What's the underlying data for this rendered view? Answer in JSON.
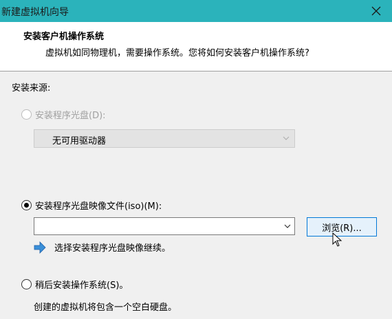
{
  "window": {
    "title": "新建虚拟机向导"
  },
  "header": {
    "title": "安装客户机操作系统",
    "description": "虚拟机如同物理机，需要操作系统。您将如何安装客户机操作系统?"
  },
  "install_source": {
    "label": "安装来源:",
    "disc_option": {
      "label": "安装程序光盘(D):",
      "selected": false,
      "disabled": true
    },
    "disc_drive": {
      "value": "无可用驱动器"
    },
    "iso_option": {
      "label": "安装程序光盘映像文件(iso)(M):",
      "selected": true
    },
    "iso_path": {
      "value": ""
    },
    "browse_label": "浏览(R)...",
    "hint_text": "选择安装程序光盘映像继续。",
    "later_option": {
      "label": "稍后安装操作系统(S)。",
      "selected": false
    },
    "later_description": "创建的虚拟机将包含一个空白硬盘。"
  },
  "colors": {
    "titlebar": "#2bb3bb",
    "button_border": "#0078d7",
    "info_arrow": "#3a8fd8"
  }
}
